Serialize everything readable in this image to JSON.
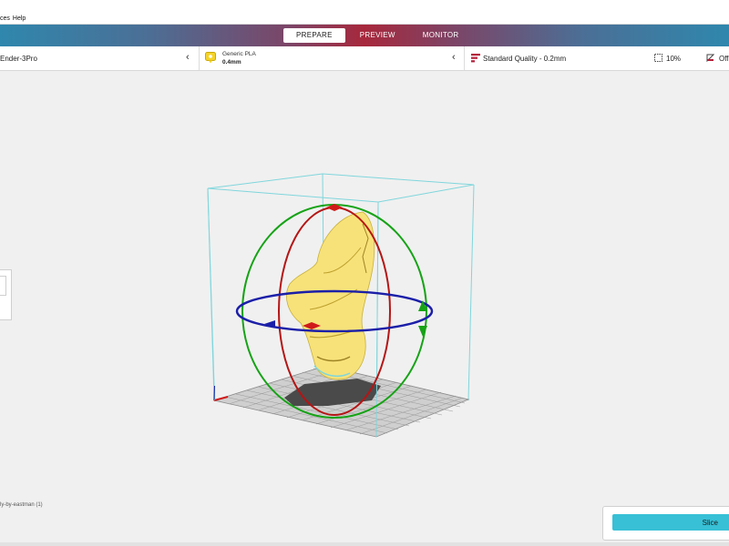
{
  "menu": {
    "items": [
      "ces",
      "Help"
    ]
  },
  "stages": {
    "tabs": [
      {
        "label": "PREPARE"
      },
      {
        "label": "PREVIEW"
      },
      {
        "label": "MONITOR"
      }
    ]
  },
  "toolbar": {
    "printer": "Ender-3Pro",
    "material_name": "Generic PLA",
    "nozzle": "0.4mm",
    "quality": "Standard Quality - 0.2mm",
    "infill": "10%",
    "support": "Off"
  },
  "object": {
    "name": "ly-by-eastman (1)"
  },
  "slice": {
    "label": "Slice"
  },
  "colors": {
    "accent": "#37c0d6",
    "model": "#f7e27a",
    "ring_x": "#d01a1a",
    "ring_y": "#16a316",
    "ring_z": "#1b1fa8",
    "frame": "#7fd6dc"
  }
}
